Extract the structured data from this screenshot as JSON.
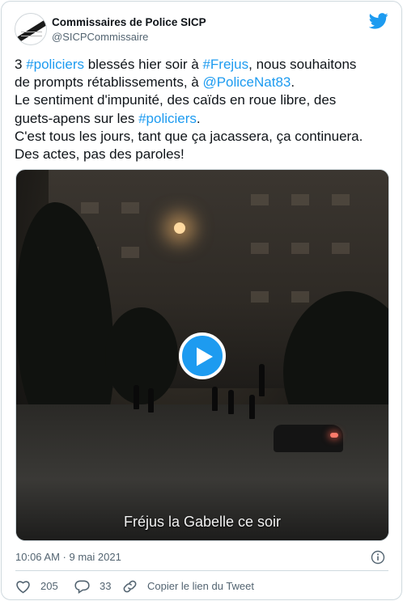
{
  "author": {
    "display_name": "Commissaires de Police SICP",
    "handle": "@SICPCommissaire"
  },
  "tweet": {
    "lines": [
      [
        {
          "text": "3 ",
          "link": false
        },
        {
          "text": "#policiers",
          "link": true
        },
        {
          "text": " blessés hier soir à ",
          "link": false
        },
        {
          "text": "#Frejus",
          "link": true
        },
        {
          "text": ", nous souhaitons",
          "link": false
        }
      ],
      [
        {
          "text": "de prompts rétablissements, à ",
          "link": false
        },
        {
          "text": "@PoliceNat83",
          "link": true
        },
        {
          "text": ".",
          "link": false
        }
      ],
      [
        {
          "text": "Le sentiment d'impunité, des caïds en roue libre, des",
          "link": false
        }
      ],
      [
        {
          "text": "guets-apens sur les ",
          "link": false
        },
        {
          "text": "#policiers",
          "link": true
        },
        {
          "text": ".",
          "link": false
        }
      ],
      [
        {
          "text": "C'est tous les jours, tant que ça jacassera, ça continuera.",
          "link": false
        }
      ],
      [
        {
          "text": "Des actes, pas des paroles!",
          "link": false
        }
      ]
    ]
  },
  "media": {
    "caption": "Fréjus la Gabelle ce soir",
    "play_icon": "play-icon"
  },
  "meta": {
    "timestamp": "10:06 AM · 9 mai 2021",
    "info_icon": "info-icon"
  },
  "actions": {
    "likes": "205",
    "replies": "33",
    "copy_link": "Copier le lien du Tweet"
  },
  "colors": {
    "link": "#1d9bf0",
    "text": "#0f1419",
    "secondary": "#536471",
    "like": "#f91880"
  }
}
